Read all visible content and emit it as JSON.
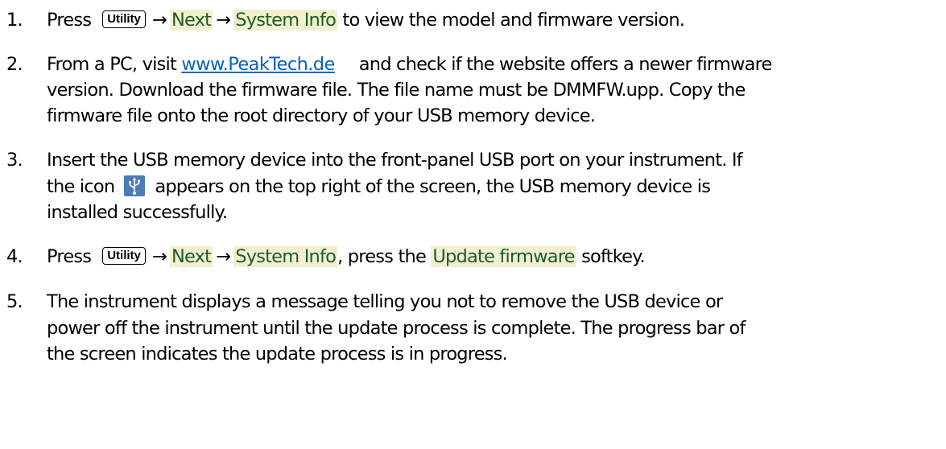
{
  "steps": [
    {
      "number": "1.",
      "press": "Press",
      "key": "Utility",
      "arrow1": "→",
      "next": "Next",
      "arrow2": "→",
      "system_info": "System Info",
      "tail": " to view the model and firmware version."
    },
    {
      "number": "2.",
      "lead": "From a PC, visit ",
      "link": "www.PeakTech.de",
      "rest_line1": "and check if the website offers a newer firmware",
      "line2": "version. Download the firmware file. The file name must be DMMFW.upp. Copy the",
      "line3": "firmware file onto the root directory of your USB memory device."
    },
    {
      "number": "3.",
      "line1": "Insert the USB memory device into the front-panel USB port on your instrument. If",
      "line2_a": "the icon",
      "icon": "usb-icon",
      "line2_b": "appears on the top right of the screen, the USB memory device is",
      "line3": "installed successfully."
    },
    {
      "number": "4.",
      "press": "Press",
      "key": "Utility",
      "arrow1": "→",
      "next": "Next",
      "arrow2": "→",
      "system_info": "System Info",
      "mid": ", press the ",
      "update_firmware": "Update firmware",
      "tail": " softkey."
    },
    {
      "number": "5.",
      "line1": "The instrument displays a message telling you not to remove the USB device or",
      "line2": "power off the instrument until the update process is complete. The progress bar of",
      "line3": "the screen indicates the update process is in progress."
    }
  ],
  "colors": {
    "highlight_bg": "#f2f0cf",
    "highlight_text": "#1b5e27",
    "link": "#0563c1",
    "usb_icon_bg": "#4a7db8"
  }
}
